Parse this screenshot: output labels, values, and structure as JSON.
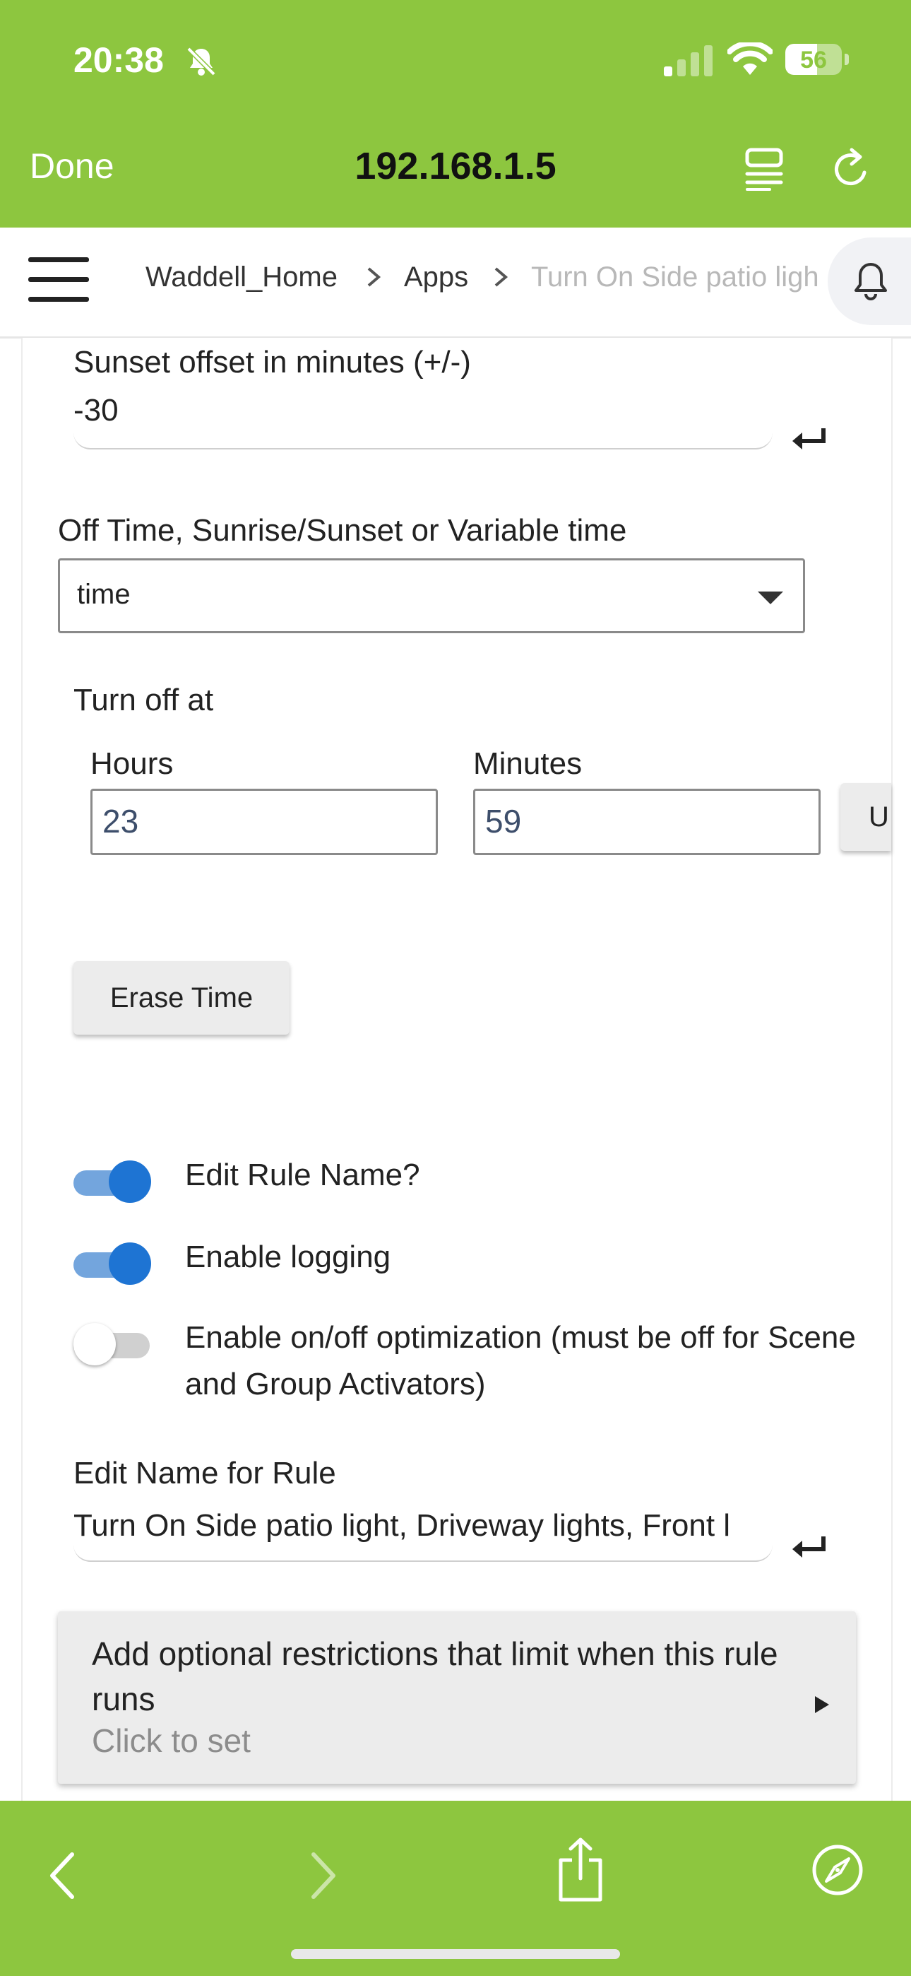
{
  "status_bar": {
    "time": "20:38",
    "battery": "56",
    "battery_level_percent": 56
  },
  "browser": {
    "done_label": "Done",
    "url": "192.168.1.5"
  },
  "app_bar": {
    "breadcrumb": [
      "Waddell_Home",
      "Apps",
      "Turn On Side patio ligh"
    ]
  },
  "form": {
    "sunset_offset": {
      "label": "Sunset offset in minutes (+/-)",
      "value": "-30"
    },
    "off_time_type": {
      "label": "Off Time, Sunrise/Sunset or Variable time",
      "value": "time"
    },
    "turn_off_at": {
      "label": "Turn off at",
      "hours_label": "Hours",
      "hours_value": "23",
      "minutes_label": "Minutes",
      "minutes_value": "59",
      "update_label": "U"
    },
    "erase_time_label": "Erase Time",
    "toggles": [
      {
        "label": "Edit Rule Name?",
        "on": true
      },
      {
        "label": "Enable logging",
        "on": true
      },
      {
        "label": "Enable on/off optimization (must be off for Scene and Group Activators)",
        "on": false
      }
    ],
    "rule_name": {
      "label": "Edit Name for Rule",
      "value": "Turn On Side patio light, Driveway lights, Front l"
    },
    "restrictions": {
      "title": "Add optional restrictions that limit when this rule runs",
      "subtitle": "Click to set"
    }
  },
  "colors": {
    "browser_chrome": "#8dc63f",
    "toggle_on": "#1e74d3"
  }
}
